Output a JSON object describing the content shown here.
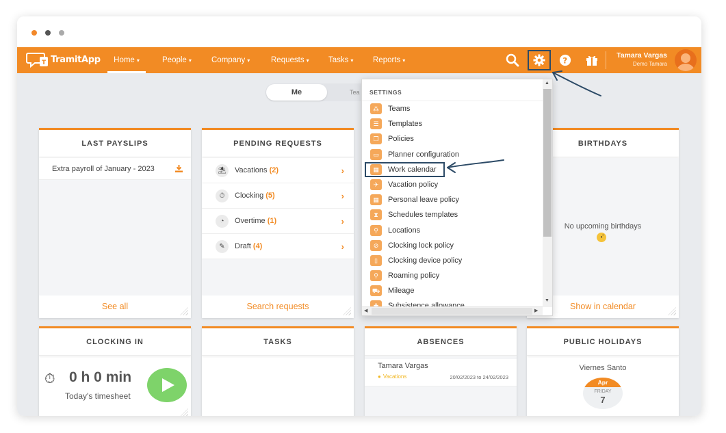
{
  "app": {
    "name": "TramitApp"
  },
  "nav": {
    "items": [
      {
        "label": "Home"
      },
      {
        "label": "People"
      },
      {
        "label": "Company"
      },
      {
        "label": "Requests"
      },
      {
        "label": "Tasks"
      },
      {
        "label": "Reports"
      }
    ],
    "icons": [
      "search-icon",
      "gear-icon",
      "help-icon",
      "gift-icon"
    ]
  },
  "user": {
    "name": "Tamara Vargas",
    "company": "Demo Tamara"
  },
  "view_toggle": {
    "me": "Me",
    "team": "Tea"
  },
  "settings_menu": {
    "heading": "SETTINGS",
    "items": [
      {
        "label": "Teams",
        "icon": "teams-icon"
      },
      {
        "label": "Templates",
        "icon": "template-icon"
      },
      {
        "label": "Policies",
        "icon": "policy-icon"
      },
      {
        "label": "Planner configuration",
        "icon": "planner-icon"
      },
      {
        "label": "Work calendar",
        "icon": "calendar-icon"
      },
      {
        "label": "Vacation policy",
        "icon": "plane-icon"
      },
      {
        "label": "Personal leave policy",
        "icon": "calendar-icon"
      },
      {
        "label": "Schedules templates",
        "icon": "hourglass-icon"
      },
      {
        "label": "Locations",
        "icon": "location-pin-icon"
      },
      {
        "label": "Clocking lock policy",
        "icon": "lock-icon"
      },
      {
        "label": "Clocking device policy",
        "icon": "device-icon"
      },
      {
        "label": "Roaming policy",
        "icon": "location-pin-icon"
      },
      {
        "label": "Mileage",
        "icon": "car-icon"
      },
      {
        "label": "Subsistence allowance",
        "icon": "food-icon"
      }
    ]
  },
  "cards": {
    "payslips": {
      "title": "LAST PAYSLIPS",
      "item": "Extra payroll of January - 2023",
      "footer": "See all"
    },
    "requests": {
      "title": "PENDING REQUESTS",
      "rows": [
        {
          "label": "Vacations",
          "count": "(2)"
        },
        {
          "label": "Clocking",
          "count": "(5)"
        },
        {
          "label": "Overtime",
          "count": "(1)"
        },
        {
          "label": "Draft",
          "count": "(4)"
        }
      ],
      "footer": "Search requests"
    },
    "birthdays": {
      "title": "BIRTHDAYS",
      "empty": "No upcoming birthdays",
      "footer": "Show in calendar"
    },
    "clocking": {
      "title": "CLOCKING IN",
      "time": "0 h 0 min",
      "sub": "Today's timesheet"
    },
    "tasks": {
      "title": "TASKS"
    },
    "absences": {
      "title": "ABSENCES",
      "name": "Tamara Vargas",
      "type": "Vacations",
      "dates": "20/02/2023 to 24/02/2023"
    },
    "holidays": {
      "title": "PUBLIC HOLIDAYS",
      "name": "Viernes Santo",
      "month": "Apr",
      "weekday": "FRIDAY",
      "day": "7"
    }
  },
  "colors": {
    "brand": "#f28b24",
    "annotation": "#2c4a66",
    "play": "#7ed36a"
  }
}
